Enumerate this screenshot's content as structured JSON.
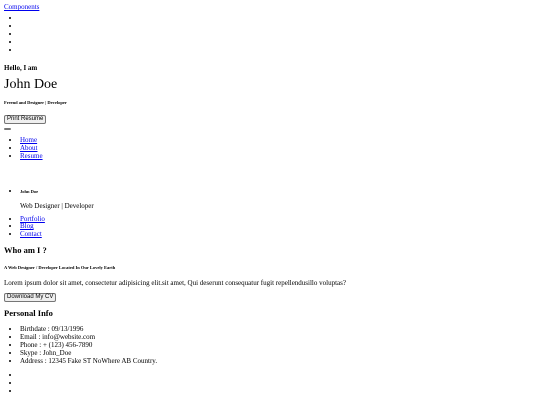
{
  "top": {
    "components_link": "Components"
  },
  "hero": {
    "hello": "Hello, I am",
    "name": "John Doe",
    "tagline": "Freend and Designer | Developer",
    "print_button": "Print Resume"
  },
  "nav": {
    "items": [
      "Home",
      "About",
      "Resume"
    ]
  },
  "profile": {
    "name": "John Doe",
    "role": "Web Designer | Developer",
    "links": [
      "Portfolio",
      "Blog",
      "Contact"
    ]
  },
  "about": {
    "title": "Who am I ?",
    "subtitle": "A Web Designer / Developer Located In Our Lovely Earth",
    "text": "Lorem ipsum dolor sit amet, consectetur adipisicing elit.sit amet, Qui deserunt consequatur fugit repellendusillo voluptas?",
    "download_button": "Download My CV"
  },
  "personal": {
    "title": "Personal Info",
    "items": [
      "Birthdate : 09/13/1996",
      "Email : info@website.com",
      "Phone : + (123) 456-7890",
      "Skype : John_Doe",
      "Address : 12345 Fake ST NoWhere AB Country."
    ]
  }
}
